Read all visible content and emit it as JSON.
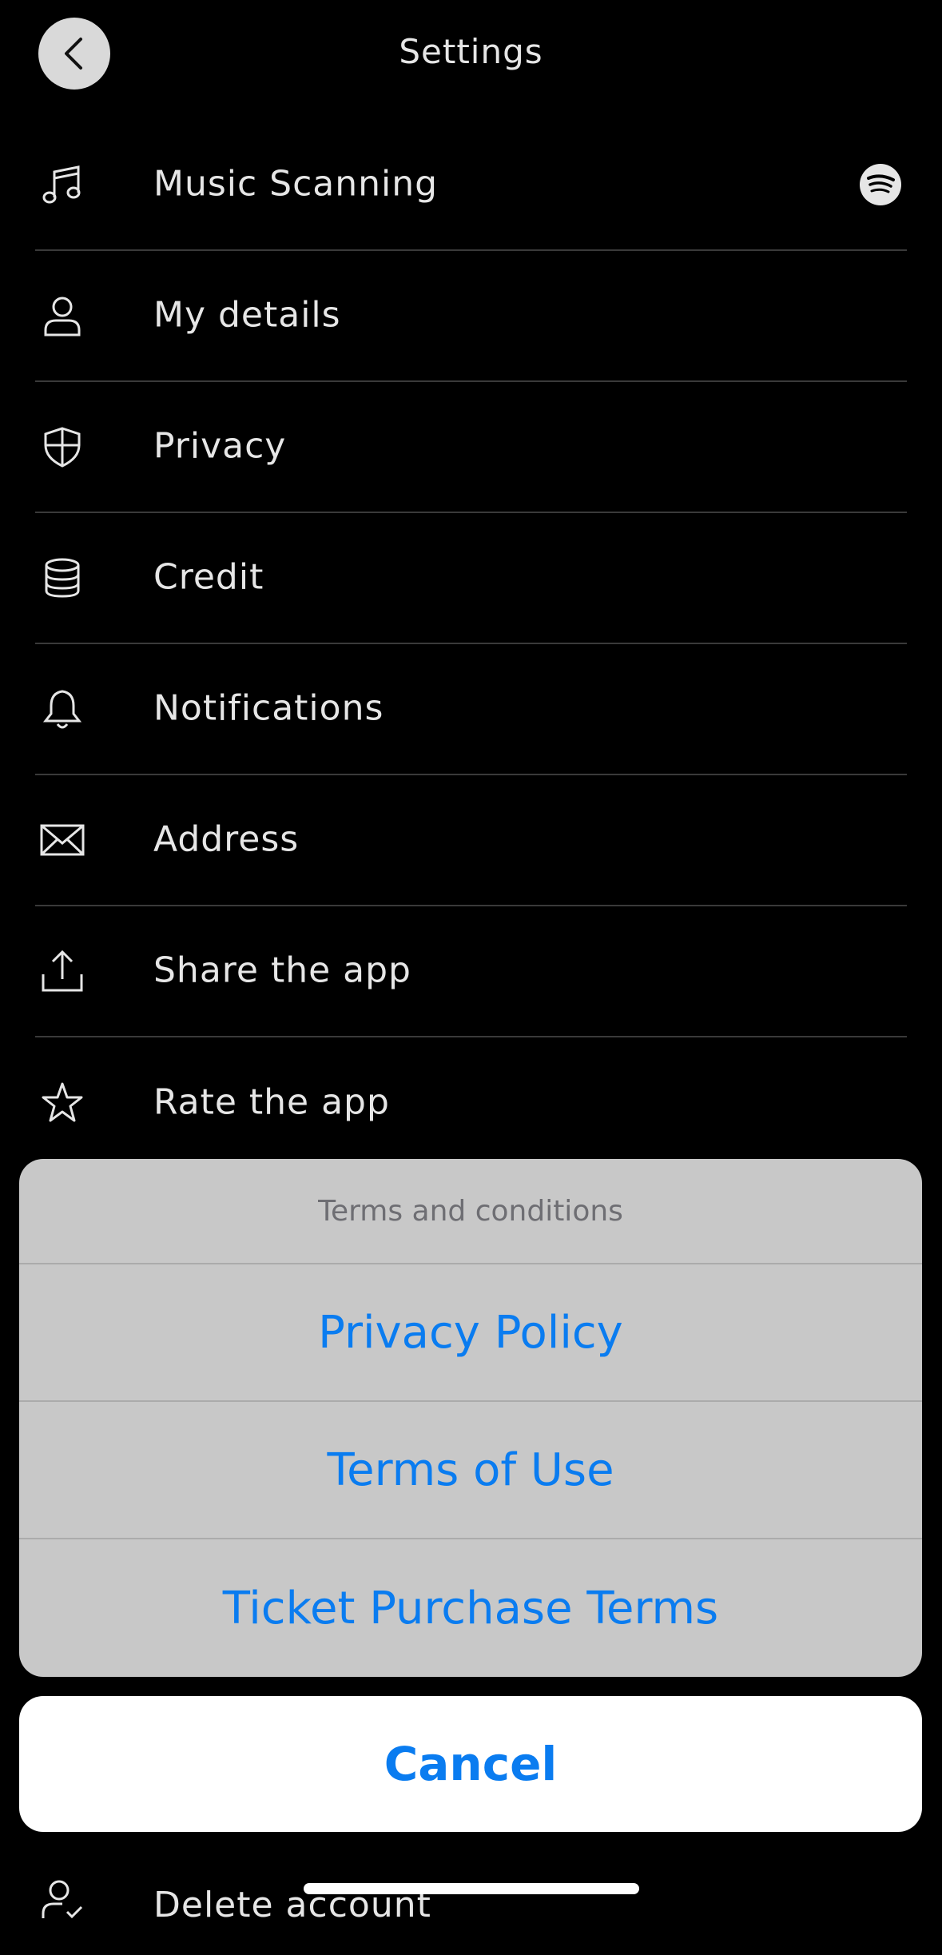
{
  "header": {
    "title": "Settings",
    "back_icon": "chevron-left-icon"
  },
  "settings": {
    "items": [
      {
        "label": "Music Scanning",
        "icon": "music-note-icon",
        "trailing_icon": "spotify-icon"
      },
      {
        "label": "My details",
        "icon": "person-icon"
      },
      {
        "label": "Privacy",
        "icon": "shield-icon"
      },
      {
        "label": "Credit",
        "icon": "coins-stack-icon"
      },
      {
        "label": "Notifications",
        "icon": "bell-icon"
      },
      {
        "label": "Address",
        "icon": "envelope-icon"
      },
      {
        "label": "Share the app",
        "icon": "share-icon"
      },
      {
        "label": "Rate the app",
        "icon": "star-icon"
      }
    ],
    "bottom_item": {
      "label": "Delete account",
      "icon": "person-remove-icon"
    }
  },
  "action_sheet": {
    "title": "Terms and conditions",
    "options": [
      "Privacy Policy",
      "Terms of Use",
      "Ticket Purchase Terms"
    ],
    "cancel_label": "Cancel"
  },
  "colors": {
    "background": "#000000",
    "sheet_background": "#c8c8c8",
    "action_blue": "#0a7cf0",
    "divider": "#3a3a3a"
  }
}
